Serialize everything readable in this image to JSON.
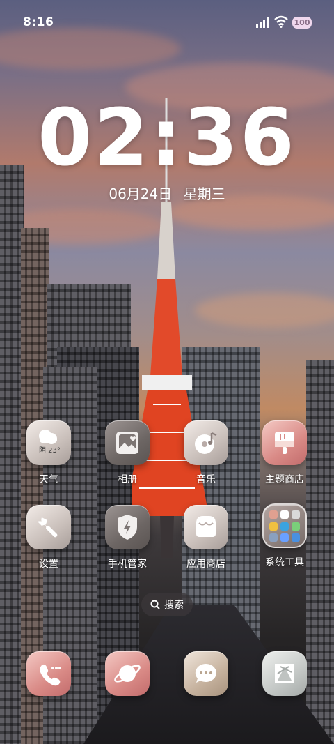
{
  "status_bar": {
    "time": "8:16",
    "battery": "100",
    "signal_icon": "cellular-signal-icon",
    "wifi_icon": "wifi-icon"
  },
  "lockscreen": {
    "clock": "02:36",
    "date": "06月24日",
    "weekday": "星期三"
  },
  "apps": [
    {
      "label": "天气",
      "icon": "weather-icon",
      "weather_text": "阴 23°"
    },
    {
      "label": "相册",
      "icon": "gallery-icon"
    },
    {
      "label": "音乐",
      "icon": "music-icon"
    },
    {
      "label": "主题商店",
      "icon": "theme-store-icon"
    },
    {
      "label": "设置",
      "icon": "settings-wrench-icon"
    },
    {
      "label": "手机管家",
      "icon": "security-shield-icon"
    },
    {
      "label": "应用商店",
      "icon": "app-store-icon"
    },
    {
      "label": "系统工具",
      "icon": "folder-icon"
    }
  ],
  "search": {
    "label": "搜索",
    "icon": "search-icon"
  },
  "dock": [
    {
      "name": "phone",
      "icon": "phone-icon"
    },
    {
      "name": "browser",
      "icon": "browser-planet-icon"
    },
    {
      "name": "messages",
      "icon": "message-bubble-icon"
    },
    {
      "name": "camera",
      "icon": "camera-aperture-icon"
    }
  ],
  "colors": {
    "folder_tiles": [
      "#e0a090",
      "#ffffff",
      "#d9d9d9",
      "#f0c040",
      "#3aa3e0",
      "#7ad07a",
      "#8aa0c0",
      "#6aa0ff",
      "#4a90e0"
    ]
  }
}
